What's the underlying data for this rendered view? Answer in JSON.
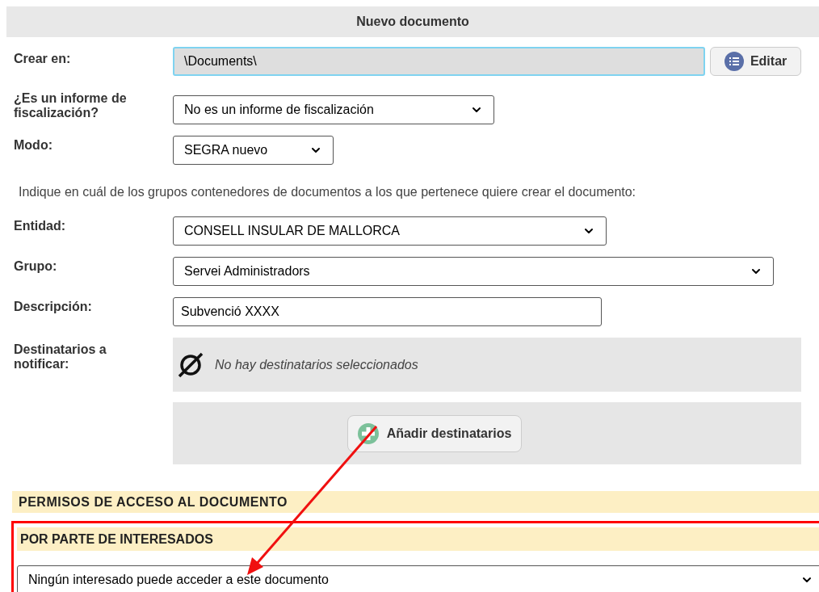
{
  "title": "Nuevo documento",
  "crear_en": {
    "label": "Crear en:",
    "value": "\\Documents\\",
    "focused": true,
    "button": "Editar"
  },
  "fiscalizacion": {
    "label": "¿Es un informe de fiscalización?",
    "value": "No es un informe de fiscalización"
  },
  "modo": {
    "label": "Modo:",
    "value": "SEGRA nuevo"
  },
  "instruction": "Indique en cuál de los grupos contenedores de documentos a los que pertenece quiere crear el documento:",
  "entidad": {
    "label": "Entidad:",
    "value": "CONSELL INSULAR DE MALLORCA"
  },
  "grupo": {
    "label": "Grupo:",
    "value": "Servei Administradors"
  },
  "descripcion": {
    "label": "Descripción:",
    "value": "Subvenció XXXX"
  },
  "destinatarios": {
    "label": "Destinatarios a notificar:",
    "empty_text": "No hay destinatarios seleccionados",
    "button": "Añadir destinatarios"
  },
  "permisos": {
    "title": "PERMISOS DE ACCESO AL DOCUMENTO",
    "section": {
      "title": "POR PARTE DE INTERESADOS",
      "highlighted": true,
      "value": "Ningún interesado puede acceder a este documento"
    }
  }
}
